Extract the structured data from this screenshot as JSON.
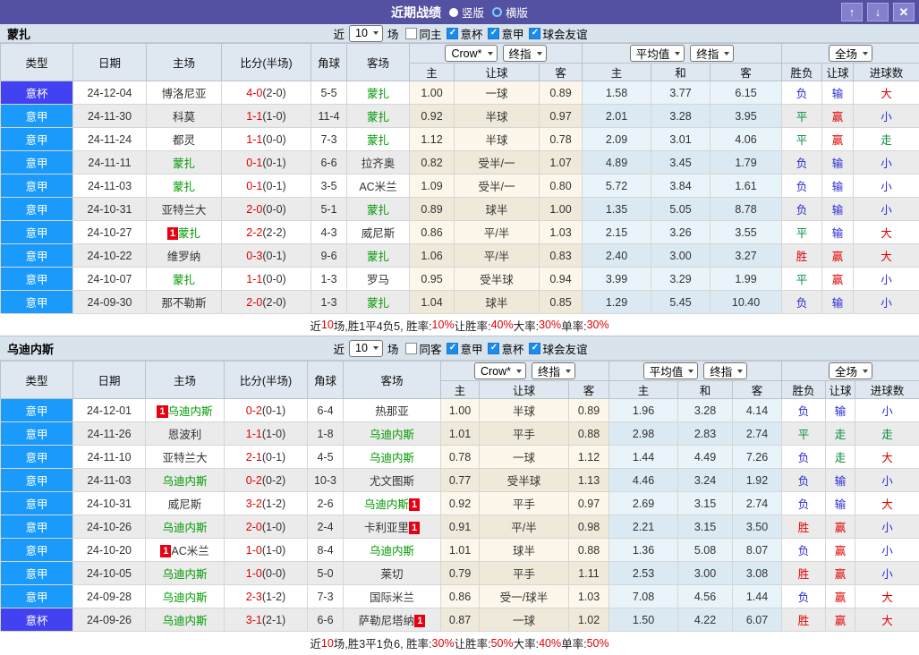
{
  "window": {
    "title": "近期战绩",
    "radio_vertical": "竖版",
    "radio_horizontal": "横版"
  },
  "icons": {
    "up": "↑",
    "down": "↓",
    "close": "✕",
    "check": "✓"
  },
  "colors": {
    "league": {
      "意甲": "#1a9bfc",
      "意杯": "#4242f2"
    },
    "result": {
      "胜": "red",
      "平": "green",
      "负": "blue",
      "赢": "red",
      "输": "blue",
      "走": "green",
      "大": "red",
      "小": "blue"
    },
    "css": {
      "red": "#e00000",
      "green": "#008a3c",
      "blue": "#2b2bd5",
      "team-green": "#009900",
      "badge-red": "#e60012",
      "titlebar": "#5551a2"
    }
  },
  "sections": [
    {
      "team": "蒙扎",
      "filter": {
        "near": "近",
        "count": "10",
        "suffix": "场",
        "same": "同主",
        "same_checked": false,
        "leagues": [
          "意杯",
          "意甲",
          "球会友谊"
        ]
      },
      "header": {
        "cols": [
          "类型",
          "日期",
          "主场",
          "比分(半场)",
          "角球",
          "客场"
        ],
        "dropdowns": [
          "Crow*",
          "终指",
          "平均值",
          "终指",
          "全场"
        ],
        "sub": [
          "主",
          "让球",
          "客",
          "主",
          "和",
          "客",
          "胜负",
          "让球",
          "进球数"
        ]
      },
      "rows": [
        {
          "type": "意杯",
          "date": "24-12-04",
          "home": "博洛尼亚",
          "away": "蒙扎",
          "ft": "4-0",
          "ht": "2-0",
          "corner": "5-5",
          "ah": "1.00",
          "hc": "一球",
          "aa": "0.89",
          "eh": "1.58",
          "ed": "3.77",
          "ea": "6.15",
          "r1": "负",
          "r2": "输",
          "r3": "大"
        },
        {
          "type": "意甲",
          "date": "24-11-30",
          "home": "科莫",
          "away": "蒙扎",
          "ft": "1-1",
          "ht": "1-0",
          "corner": "11-4",
          "ah": "0.92",
          "hc": "半球",
          "aa": "0.97",
          "eh": "2.01",
          "ed": "3.28",
          "ea": "3.95",
          "r1": "平",
          "r2": "赢",
          "r3": "小"
        },
        {
          "type": "意甲",
          "date": "24-11-24",
          "home": "都灵",
          "away": "蒙扎",
          "ft": "1-1",
          "ht": "0-0",
          "corner": "7-3",
          "ah": "1.12",
          "hc": "半球",
          "aa": "0.78",
          "eh": "2.09",
          "ed": "3.01",
          "ea": "4.06",
          "r1": "平",
          "r2": "赢",
          "r3": "走"
        },
        {
          "type": "意甲",
          "date": "24-11-11",
          "home": "蒙扎",
          "away": "拉齐奥",
          "ft": "0-1",
          "ht": "0-1",
          "corner": "6-6",
          "ah": "0.82",
          "hc": "受半/一",
          "aa": "1.07",
          "eh": "4.89",
          "ed": "3.45",
          "ea": "1.79",
          "r1": "负",
          "r2": "输",
          "r3": "小"
        },
        {
          "type": "意甲",
          "date": "24-11-03",
          "home": "蒙扎",
          "away": "AC米兰",
          "ft": "0-1",
          "ht": "0-1",
          "corner": "3-5",
          "ah": "1.09",
          "hc": "受半/一",
          "aa": "0.80",
          "eh": "5.72",
          "ed": "3.84",
          "ea": "1.61",
          "r1": "负",
          "r2": "输",
          "r3": "小"
        },
        {
          "type": "意甲",
          "date": "24-10-31",
          "home": "亚特兰大",
          "away": "蒙扎",
          "ft": "2-0",
          "ht": "0-0",
          "corner": "5-1",
          "ah": "0.89",
          "hc": "球半",
          "aa": "1.00",
          "eh": "1.35",
          "ed": "5.05",
          "ea": "8.78",
          "r1": "负",
          "r2": "输",
          "r3": "小"
        },
        {
          "type": "意甲",
          "date": "24-10-27",
          "home": "蒙扎",
          "hb": "1",
          "away": "威尼斯",
          "ft": "2-2",
          "ht": "2-2",
          "corner": "4-3",
          "ah": "0.86",
          "hc": "平/半",
          "aa": "1.03",
          "eh": "2.15",
          "ed": "3.26",
          "ea": "3.55",
          "r1": "平",
          "r2": "输",
          "r3": "大"
        },
        {
          "type": "意甲",
          "date": "24-10-22",
          "home": "维罗纳",
          "away": "蒙扎",
          "ft": "0-3",
          "ht": "0-1",
          "corner": "9-6",
          "ah": "1.06",
          "hc": "平/半",
          "aa": "0.83",
          "eh": "2.40",
          "ed": "3.00",
          "ea": "3.27",
          "r1": "胜",
          "r2": "赢",
          "r3": "大"
        },
        {
          "type": "意甲",
          "date": "24-10-07",
          "home": "蒙扎",
          "away": "罗马",
          "ft": "1-1",
          "ht": "0-0",
          "corner": "1-3",
          "ah": "0.95",
          "hc": "受半球",
          "aa": "0.94",
          "eh": "3.99",
          "ed": "3.29",
          "ea": "1.99",
          "r1": "平",
          "r2": "赢",
          "r3": "小"
        },
        {
          "type": "意甲",
          "date": "24-09-30",
          "home": "那不勒斯",
          "away": "蒙扎",
          "ft": "2-0",
          "ht": "2-0",
          "corner": "1-3",
          "ah": "1.04",
          "hc": "球半",
          "aa": "0.85",
          "eh": "1.29",
          "ed": "5.45",
          "ea": "10.40",
          "r1": "负",
          "r2": "输",
          "r3": "小"
        }
      ],
      "summary": [
        {
          "t": "近",
          "c": "k"
        },
        {
          "t": "10",
          "c": "r"
        },
        {
          "t": "场,胜1平4负5, 胜率:",
          "c": "k"
        },
        {
          "t": "10%",
          "c": "r"
        },
        {
          "t": " 让胜率:",
          "c": "k"
        },
        {
          "t": "40%",
          "c": "r"
        },
        {
          "t": " 大率:",
          "c": "k"
        },
        {
          "t": "30%",
          "c": "r"
        },
        {
          "t": " 单率:",
          "c": "k"
        },
        {
          "t": "30%",
          "c": "r"
        }
      ]
    },
    {
      "team": "乌迪内斯",
      "filter": {
        "near": "近",
        "count": "10",
        "suffix": "场",
        "same": "同客",
        "same_checked": false,
        "leagues": [
          "意甲",
          "意杯",
          "球会友谊"
        ]
      },
      "header": {
        "cols": [
          "类型",
          "日期",
          "主场",
          "比分(半场)",
          "角球",
          "客场"
        ],
        "dropdowns": [
          "Crow*",
          "终指",
          "平均值",
          "终指",
          "全场"
        ],
        "sub": [
          "主",
          "让球",
          "客",
          "主",
          "和",
          "客",
          "胜负",
          "让球",
          "进球数"
        ]
      },
      "rows": [
        {
          "type": "意甲",
          "date": "24-12-01",
          "home": "乌迪内斯",
          "hb": "1",
          "away": "热那亚",
          "ft": "0-2",
          "ht": "0-1",
          "corner": "6-4",
          "ah": "1.00",
          "hc": "半球",
          "aa": "0.89",
          "eh": "1.96",
          "ed": "3.28",
          "ea": "4.14",
          "r1": "负",
          "r2": "输",
          "r3": "小"
        },
        {
          "type": "意甲",
          "date": "24-11-26",
          "home": "恩波利",
          "away": "乌迪内斯",
          "ft": "1-1",
          "ht": "1-0",
          "corner": "1-8",
          "ah": "1.01",
          "hc": "平手",
          "aa": "0.88",
          "eh": "2.98",
          "ed": "2.83",
          "ea": "2.74",
          "r1": "平",
          "r2": "走",
          "r3": "走"
        },
        {
          "type": "意甲",
          "date": "24-11-10",
          "home": "亚特兰大",
          "away": "乌迪内斯",
          "ft": "2-1",
          "ht": "0-1",
          "corner": "4-5",
          "ah": "0.78",
          "hc": "一球",
          "aa": "1.12",
          "eh": "1.44",
          "ed": "4.49",
          "ea": "7.26",
          "r1": "负",
          "r2": "走",
          "r3": "大"
        },
        {
          "type": "意甲",
          "date": "24-11-03",
          "home": "乌迪内斯",
          "away": "尤文图斯",
          "ft": "0-2",
          "ht": "0-2",
          "corner": "10-3",
          "ah": "0.77",
          "hc": "受半球",
          "aa": "1.13",
          "eh": "4.46",
          "ed": "3.24",
          "ea": "1.92",
          "r1": "负",
          "r2": "输",
          "r3": "小"
        },
        {
          "type": "意甲",
          "date": "24-10-31",
          "home": "威尼斯",
          "away": "乌迪内斯",
          "ab": "1",
          "ft": "3-2",
          "ht": "1-2",
          "corner": "2-6",
          "ah": "0.92",
          "hc": "平手",
          "aa": "0.97",
          "eh": "2.69",
          "ed": "3.15",
          "ea": "2.74",
          "r1": "负",
          "r2": "输",
          "r3": "大"
        },
        {
          "type": "意甲",
          "date": "24-10-26",
          "home": "乌迪内斯",
          "away": "卡利亚里",
          "ab": "1",
          "ft": "2-0",
          "ht": "1-0",
          "corner": "2-4",
          "ah": "0.91",
          "hc": "平/半",
          "aa": "0.98",
          "eh": "2.21",
          "ed": "3.15",
          "ea": "3.50",
          "r1": "胜",
          "r2": "赢",
          "r3": "小"
        },
        {
          "type": "意甲",
          "date": "24-10-20",
          "home": "AC米兰",
          "hb": "1",
          "away": "乌迪内斯",
          "ft": "1-0",
          "ht": "1-0",
          "corner": "8-4",
          "ah": "1.01",
          "hc": "球半",
          "aa": "0.88",
          "eh": "1.36",
          "ed": "5.08",
          "ea": "8.07",
          "r1": "负",
          "r2": "赢",
          "r3": "小"
        },
        {
          "type": "意甲",
          "date": "24-10-05",
          "home": "乌迪内斯",
          "away": "莱切",
          "ft": "1-0",
          "ht": "0-0",
          "corner": "5-0",
          "ah": "0.79",
          "hc": "平手",
          "aa": "1.11",
          "eh": "2.53",
          "ed": "3.00",
          "ea": "3.08",
          "r1": "胜",
          "r2": "赢",
          "r3": "小"
        },
        {
          "type": "意甲",
          "date": "24-09-28",
          "home": "乌迪内斯",
          "away": "国际米兰",
          "ft": "2-3",
          "ht": "1-2",
          "corner": "7-3",
          "ah": "0.86",
          "hc": "受一/球半",
          "aa": "1.03",
          "eh": "7.08",
          "ed": "4.56",
          "ea": "1.44",
          "r1": "负",
          "r2": "赢",
          "r3": "大"
        },
        {
          "type": "意杯",
          "date": "24-09-26",
          "home": "乌迪内斯",
          "away": "萨勒尼塔纳",
          "ab": "1",
          "ft": "3-1",
          "ht": "2-1",
          "corner": "6-6",
          "ah": "0.87",
          "hc": "一球",
          "aa": "1.02",
          "eh": "1.50",
          "ed": "4.22",
          "ea": "6.07",
          "r1": "胜",
          "r2": "赢",
          "r3": "大"
        }
      ],
      "summary": [
        {
          "t": "近",
          "c": "k"
        },
        {
          "t": "10",
          "c": "r"
        },
        {
          "t": "场,胜3平1负6, 胜率:",
          "c": "k"
        },
        {
          "t": "30%",
          "c": "r"
        },
        {
          "t": " 让胜率:",
          "c": "k"
        },
        {
          "t": "50%",
          "c": "r"
        },
        {
          "t": " 大率:",
          "c": "k"
        },
        {
          "t": "40%",
          "c": "r"
        },
        {
          "t": " 单率:",
          "c": "k"
        },
        {
          "t": "50%",
          "c": "r"
        }
      ]
    }
  ]
}
